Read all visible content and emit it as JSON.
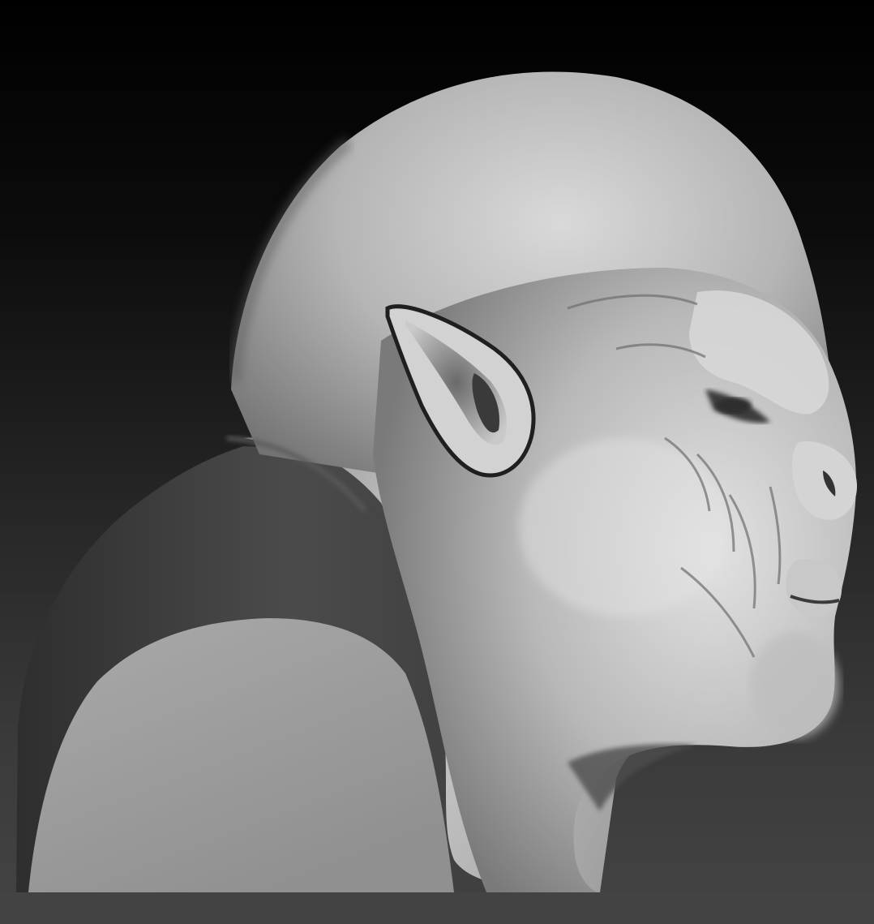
{
  "scene": {
    "subject": "sculpted-creature-head-bust",
    "render_style": "grayscale-clay-matcap",
    "background_colors": {
      "top": "#000000",
      "bottom": "#444444"
    },
    "material_colors": {
      "highlight": "#e6e6e6",
      "midtone": "#a8a8a8",
      "shadow": "#4a4a4a",
      "backdrop_panel": "#9a9a9a"
    }
  }
}
